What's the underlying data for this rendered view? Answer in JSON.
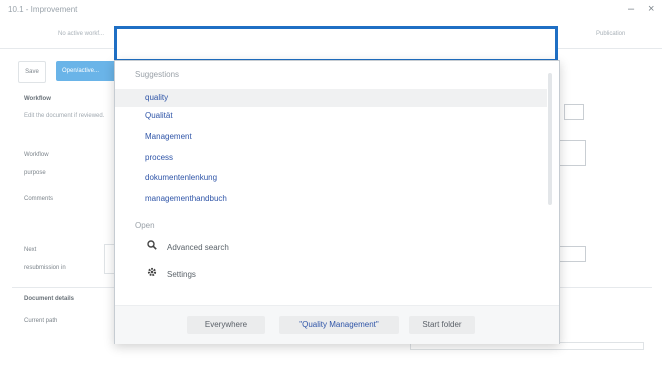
{
  "window": {
    "title": "10.1 - Improvement",
    "minimize": "–",
    "close": "×"
  },
  "header": {
    "no_active": "No active workf...",
    "publication": "Publication"
  },
  "tabs": {
    "save": "Save",
    "active": "Open/active..."
  },
  "workflow": {
    "heading": "Workflow",
    "description": "Edit the document if reviewed.",
    "label_workflow": "Workflow",
    "label_purpose": "purpose",
    "label_comments": "Comments",
    "label_next": "Next",
    "label_resubmission": "resubmission in"
  },
  "document_details": {
    "heading": "Document details",
    "current_path": "Current path"
  },
  "search": {
    "placeholder": "",
    "value": ""
  },
  "suggestions": {
    "heading": "Suggestions",
    "items": [
      "quality",
      "Qualität",
      "Management",
      "process",
      "dokumentenlenkung",
      "managementhandbuch"
    ]
  },
  "open": {
    "heading": "Open",
    "items": [
      {
        "icon": "search-icon",
        "label": "Advanced search"
      },
      {
        "icon": "gear-icon",
        "label": "Settings"
      }
    ]
  },
  "scopes": [
    "Everywhere",
    "\"Quality Management\"",
    "Start folder"
  ]
}
